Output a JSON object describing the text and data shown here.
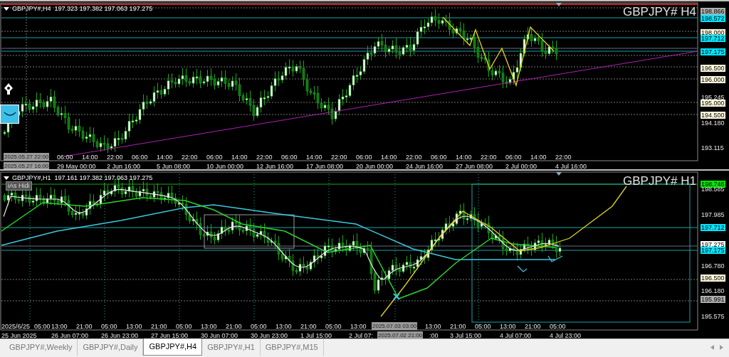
{
  "charts": [
    {
      "header": "GBPJPY#,H4  197.323 197.382 197.063 197.275",
      "symbol": "GBPJPY# H4",
      "price_labels": [
        {
          "text": "198.866",
          "kind": "marker"
        },
        {
          "text": "198.572",
          "kind": "line"
        },
        {
          "text": "198.000",
          "kind": "level"
        },
        {
          "text": "197.712",
          "kind": "line"
        },
        {
          "text": "197.175",
          "kind": "line"
        },
        {
          "text": "196.500",
          "kind": "level"
        },
        {
          "text": "196.000",
          "kind": "level"
        },
        {
          "text": "195.245",
          "kind": "tick"
        },
        {
          "text": "195.000",
          "kind": "level"
        },
        {
          "text": "194.500",
          "kind": "level"
        },
        {
          "text": "194.180",
          "kind": "tick"
        },
        {
          "text": "193.115",
          "kind": "tick"
        }
      ],
      "crosshair_time": "2025.05.27 22:00",
      "crosshair_date": "2025.05.27 16:00",
      "time_row_1": [
        "06:00",
        "14:00",
        "22:00",
        "06:00",
        "14:00",
        "22:00",
        "06:00",
        "14:00",
        "22:00",
        "06:00",
        "14:00",
        "22:00",
        "06:00",
        "14:00",
        "22:00",
        "06:00",
        "14:00",
        "22:00",
        "06:00",
        "14:00",
        "22:00"
      ],
      "time_row_2": [
        "29 May 00:00",
        "2 Jun 16:00",
        "5 Jun 08:00",
        "10 Jun 00:00",
        "12 Jun 16:00",
        "17 Jun 08:00",
        "20 Jun 00:00",
        "24 Jun 16:00",
        "27 Jun 08:00",
        "2 Jul 00:00",
        "4 Jul 16:00"
      ]
    },
    {
      "header": "GBPJPY#,H1  197.161 197.382 197.063 197.275",
      "symbol": "GBPJPY# H1",
      "button": "iAs Hidi",
      "price_labels": [
        {
          "text": "198.746",
          "kind": "high"
        },
        {
          "text": "198.585",
          "kind": "tick"
        },
        {
          "text": "197.985",
          "kind": "tick"
        },
        {
          "text": "197.712",
          "kind": "line"
        },
        {
          "text": "197.275",
          "kind": "price"
        },
        {
          "text": "197.175",
          "kind": "line"
        },
        {
          "text": "196.780",
          "kind": "tick"
        },
        {
          "text": "196.500",
          "kind": "level"
        },
        {
          "text": "196.180",
          "kind": "tick"
        },
        {
          "text": "195.991",
          "kind": "marker"
        },
        {
          "text": "195.575",
          "kind": "tick"
        }
      ],
      "crosshair_time": "2025.07.03 03:00",
      "crosshair_date": "2025.07.02 21:00",
      "time_row_1": [
        "2025/6/25",
        "05:00",
        "13:00",
        "21:00",
        "05:00",
        "13:00",
        "21:00",
        "05:00",
        "13:00",
        "21:00",
        "05:00",
        "13:00",
        "21:00",
        "05:00",
        "13:00",
        "13:00",
        "21:00",
        "05:00",
        "13:00",
        "21:00",
        "05:00"
      ],
      "time_row_2": [
        "25 Jun 2025",
        "26 Jun 07:00",
        "26 Jun 23:00",
        "27 Jun 15:00",
        "30 Jun 07:00",
        "30 Jun 23:00",
        "1 Jul 15:00",
        "2 Jul 07:",
        ":00",
        "3 Jul 15:00",
        "4 Jul 07:00",
        "4 Jul 23:00"
      ]
    }
  ],
  "tabs": [
    {
      "label": "GBPJPY#,Weekly",
      "selected": false
    },
    {
      "label": "GBPJPY#,Daily",
      "selected": false
    },
    {
      "label": "GBPJPY#,H4",
      "selected": true
    },
    {
      "label": "GBPJPY#,H1",
      "selected": false
    },
    {
      "label": "GBPJPY#,M15",
      "selected": false
    }
  ]
}
